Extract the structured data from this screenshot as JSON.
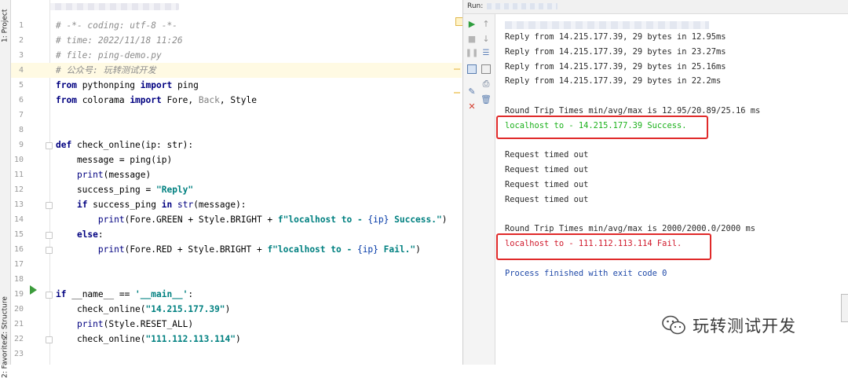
{
  "sidebar": {
    "tabs": {
      "project": "1: Project",
      "structure": "Z: Structure",
      "favorites": "2: Favorites"
    }
  },
  "editor": {
    "lines": [
      {
        "n": "1",
        "tokens": [
          {
            "t": "# -*- coding: utf-8 -*-",
            "c": "comment"
          }
        ]
      },
      {
        "n": "2",
        "tokens": [
          {
            "t": "# time: 2022/11/18 11:26",
            "c": "comment"
          }
        ]
      },
      {
        "n": "3",
        "tokens": [
          {
            "t": "# file: ping-demo.py",
            "c": "comment"
          }
        ]
      },
      {
        "n": "4",
        "tokens": [
          {
            "t": "# 公众号: 玩转测试开发",
            "c": "comment"
          }
        ]
      },
      {
        "n": "5",
        "tokens": [
          {
            "t": "from",
            "c": "kw"
          },
          {
            "t": " pythonping ",
            "c": ""
          },
          {
            "t": "import",
            "c": "kw"
          },
          {
            "t": " ping",
            "c": ""
          }
        ]
      },
      {
        "n": "6",
        "tokens": [
          {
            "t": "from",
            "c": "kw"
          },
          {
            "t": " colorama ",
            "c": ""
          },
          {
            "t": "import",
            "c": "kw"
          },
          {
            "t": " Fore, ",
            "c": ""
          },
          {
            "t": "Back",
            "c": "fade"
          },
          {
            "t": ", Style",
            "c": ""
          }
        ]
      },
      {
        "n": "7",
        "tokens": []
      },
      {
        "n": "8",
        "tokens": []
      },
      {
        "n": "9",
        "tokens": [
          {
            "t": "def",
            "c": "kw"
          },
          {
            "t": " check_online(ip: str):",
            "c": ""
          }
        ]
      },
      {
        "n": "10",
        "tokens": [
          {
            "t": "    message = ping(ip)",
            "c": ""
          }
        ]
      },
      {
        "n": "11",
        "tokens": [
          {
            "t": "    ",
            "c": ""
          },
          {
            "t": "print",
            "c": "builtin"
          },
          {
            "t": "(message)",
            "c": ""
          }
        ]
      },
      {
        "n": "12",
        "tokens": [
          {
            "t": "    success_ping = ",
            "c": ""
          },
          {
            "t": "\"Reply\"",
            "c": "str"
          }
        ]
      },
      {
        "n": "13",
        "tokens": [
          {
            "t": "    ",
            "c": ""
          },
          {
            "t": "if",
            "c": "kw"
          },
          {
            "t": " success_ping ",
            "c": ""
          },
          {
            "t": "in",
            "c": "kw"
          },
          {
            "t": " ",
            "c": ""
          },
          {
            "t": "str",
            "c": "builtin"
          },
          {
            "t": "(message):",
            "c": ""
          }
        ]
      },
      {
        "n": "14",
        "tokens": [
          {
            "t": "        ",
            "c": ""
          },
          {
            "t": "print",
            "c": "builtin"
          },
          {
            "t": "(Fore.GREEN + Style.BRIGHT + ",
            "c": ""
          },
          {
            "t": "f\"localhost to - ",
            "c": "str"
          },
          {
            "t": "{ip}",
            "c": "brace"
          },
          {
            "t": " Success.\"",
            "c": "str"
          },
          {
            "t": ")",
            "c": ""
          }
        ]
      },
      {
        "n": "15",
        "tokens": [
          {
            "t": "    ",
            "c": ""
          },
          {
            "t": "else",
            "c": "kw"
          },
          {
            "t": ":",
            "c": ""
          }
        ]
      },
      {
        "n": "16",
        "tokens": [
          {
            "t": "        ",
            "c": ""
          },
          {
            "t": "print",
            "c": "builtin"
          },
          {
            "t": "(Fore.RED + Style.BRIGHT + ",
            "c": ""
          },
          {
            "t": "f\"localhost to - ",
            "c": "str"
          },
          {
            "t": "{ip}",
            "c": "brace"
          },
          {
            "t": " Fail.\"",
            "c": "str"
          },
          {
            "t": ")",
            "c": ""
          }
        ]
      },
      {
        "n": "17",
        "tokens": []
      },
      {
        "n": "18",
        "tokens": []
      },
      {
        "n": "19",
        "tokens": [
          {
            "t": "if",
            "c": "kw"
          },
          {
            "t": " __name__ == ",
            "c": ""
          },
          {
            "t": "'__main__'",
            "c": "str"
          },
          {
            "t": ":",
            "c": ""
          }
        ]
      },
      {
        "n": "20",
        "tokens": [
          {
            "t": "    check_online(",
            "c": ""
          },
          {
            "t": "\"14.215.177.39\"",
            "c": "str"
          },
          {
            "t": ")",
            "c": ""
          }
        ]
      },
      {
        "n": "21",
        "tokens": [
          {
            "t": "    ",
            "c": ""
          },
          {
            "t": "print",
            "c": "builtin"
          },
          {
            "t": "(Style.RESET_ALL)",
            "c": ""
          }
        ]
      },
      {
        "n": "22",
        "tokens": [
          {
            "t": "    check_online(",
            "c": ""
          },
          {
            "t": "\"111.112.113.114\"",
            "c": "str"
          },
          {
            "t": ")",
            "c": ""
          }
        ]
      },
      {
        "n": "23",
        "tokens": []
      }
    ]
  },
  "run": {
    "label": "Run:",
    "console": [
      {
        "text": "Reply from 14.215.177.39, 29 bytes in 12.95ms",
        "style": ""
      },
      {
        "text": "Reply from 14.215.177.39, 29 bytes in 23.27ms",
        "style": ""
      },
      {
        "text": "Reply from 14.215.177.39, 29 bytes in 25.16ms",
        "style": ""
      },
      {
        "text": "Reply from 14.215.177.39, 29 bytes in 22.2ms",
        "style": ""
      },
      {
        "text": "",
        "style": ""
      },
      {
        "text": "Round Trip Times min/avg/max is 12.95/20.89/25.16 ms",
        "style": ""
      },
      {
        "text": "localhost to - 14.215.177.39 Success.",
        "style": "green"
      },
      {
        "text": "",
        "style": ""
      },
      {
        "text": "Request timed out",
        "style": ""
      },
      {
        "text": "Request timed out",
        "style": ""
      },
      {
        "text": "Request timed out",
        "style": ""
      },
      {
        "text": "Request timed out",
        "style": ""
      },
      {
        "text": "",
        "style": ""
      },
      {
        "text": "Round Trip Times min/avg/max is 2000/2000.0/2000 ms",
        "style": ""
      },
      {
        "text": "localhost to - 111.112.113.114 Fail.",
        "style": "red"
      },
      {
        "text": "",
        "style": ""
      },
      {
        "text": "Process finished with exit code 0",
        "style": "blue"
      }
    ]
  },
  "watermark": {
    "text": "玩转测试开发"
  },
  "colors": {
    "success": "#1bb11b",
    "fail": "#d0182a",
    "process": "#1f49a8",
    "highlight_box": "#e02a2a"
  }
}
